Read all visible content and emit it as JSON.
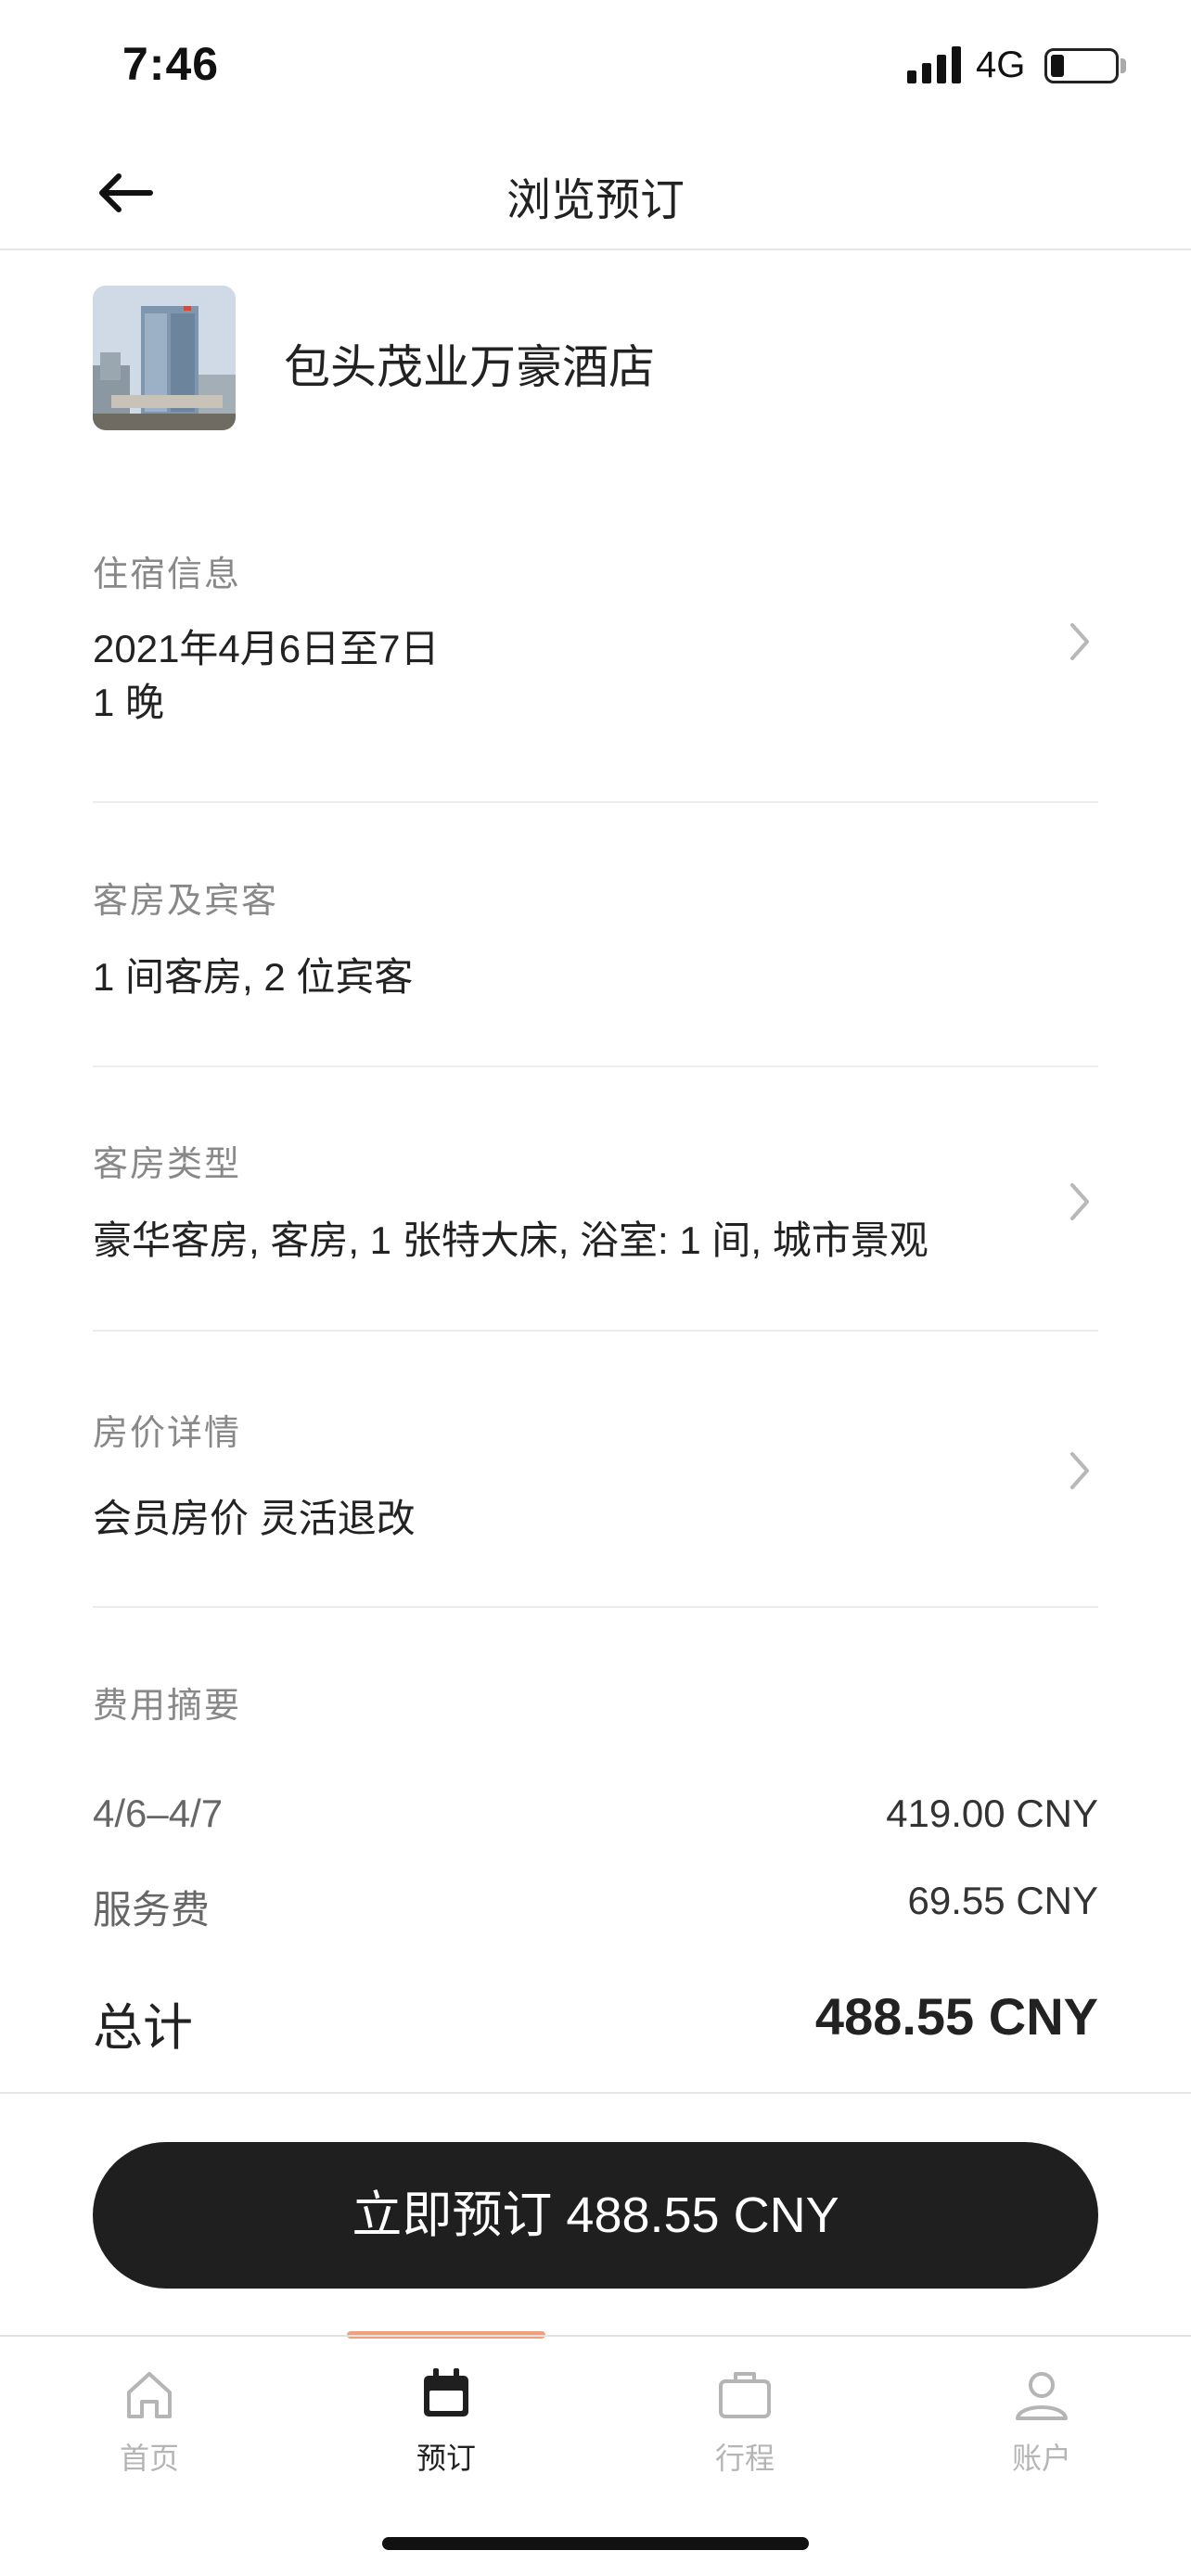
{
  "status_bar": {
    "time": "7:46",
    "network": "4G"
  },
  "nav": {
    "title": "浏览预订",
    "back_icon": "arrow-left-icon"
  },
  "hotel": {
    "name": "包头茂业万豪酒店"
  },
  "stay_info": {
    "label": "住宿信息",
    "dates": "2021年4月6日至7日",
    "nights": "1 晚"
  },
  "rooms_guests": {
    "label": "客房及宾客",
    "value": "1 间客房, 2 位宾客"
  },
  "room_type": {
    "label": "客房类型",
    "value": "豪华客房, 客房, 1  张特大床, 浴室: 1 间, 城市景观"
  },
  "rate_details": {
    "label": "房价详情",
    "value": "会员房价 灵活退改"
  },
  "fee_summary": {
    "label": "费用摘要",
    "rows": [
      {
        "label": "4/6–4/7",
        "amount": "419.00 CNY"
      },
      {
        "label": "服务费",
        "amount": "69.55 CNY"
      }
    ],
    "total_label": "总计",
    "total_amount": "488.55 CNY"
  },
  "book_button": {
    "label": "立即预订 488.55 CNY"
  },
  "tab_bar": {
    "active_index": 1,
    "indicator_color": "#f0a07a",
    "tabs": [
      {
        "label": "首页",
        "icon": "home-icon"
      },
      {
        "label": "预订",
        "icon": "calendar-icon"
      },
      {
        "label": "行程",
        "icon": "briefcase-icon"
      },
      {
        "label": "账户",
        "icon": "user-icon"
      }
    ]
  }
}
